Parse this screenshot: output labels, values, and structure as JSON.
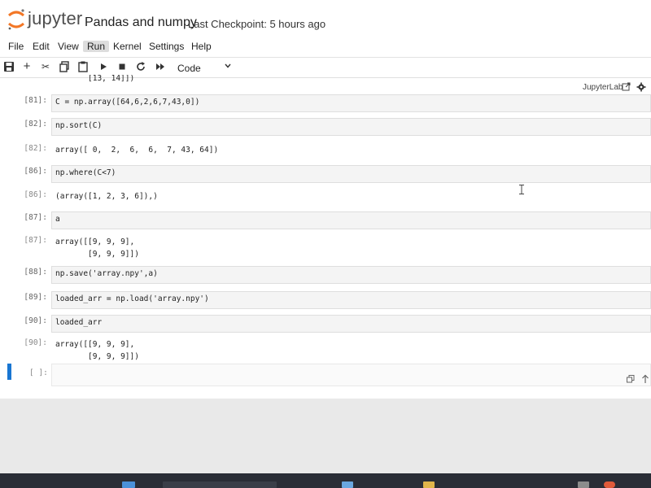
{
  "header": {
    "brand": "jupyter",
    "notebook_title": "Pandas and numpy",
    "checkpoint": "Last Checkpoint: 5 hours ago"
  },
  "menu": [
    "File",
    "Edit",
    "View",
    "Run",
    "Kernel",
    "Settings",
    "Help"
  ],
  "menu_active": "Run",
  "toolbar": {
    "cell_type": "Code",
    "jupyterlab_label": "JupyterLab"
  },
  "cells": {
    "partial_output": "[13, 14]])",
    "c81_prompt": "[81]:",
    "c81_code": "C = np.array([64,6,2,6,7,43,0])",
    "c82_prompt": "[82]:",
    "c82_code": "np.sort(C)",
    "c82_out_prompt": "[82]:",
    "c82_out": "array([ 0,  2,  6,  6,  7, 43, 64])",
    "c86_prompt": "[86]:",
    "c86_code": "np.where(C<7)",
    "c86_out_prompt": "[86]:",
    "c86_out": "(array([1, 2, 3, 6]),)",
    "c87_prompt": "[87]:",
    "c87_code": "a",
    "c87_out_prompt": "[87]:",
    "c87_out": "array([[9, 9, 9],\n       [9, 9, 9]])",
    "c88_prompt": "[88]:",
    "c88_code": "np.save('array.npy',a)",
    "c89_prompt": "[89]:",
    "c89_code": "loaded_arr = np.load('array.npy')",
    "c90_prompt": "[90]:",
    "c90_code": "loaded_arr",
    "c90_out_prompt": "[90]:",
    "c90_out": "array([[9, 9, 9],\n       [9, 9, 9]])",
    "active_prompt": "[ ]:"
  },
  "colors": {
    "logo_orange": "#f37726",
    "active_cell_bar": "#1976d2",
    "taskbar": "#2a2d36"
  }
}
